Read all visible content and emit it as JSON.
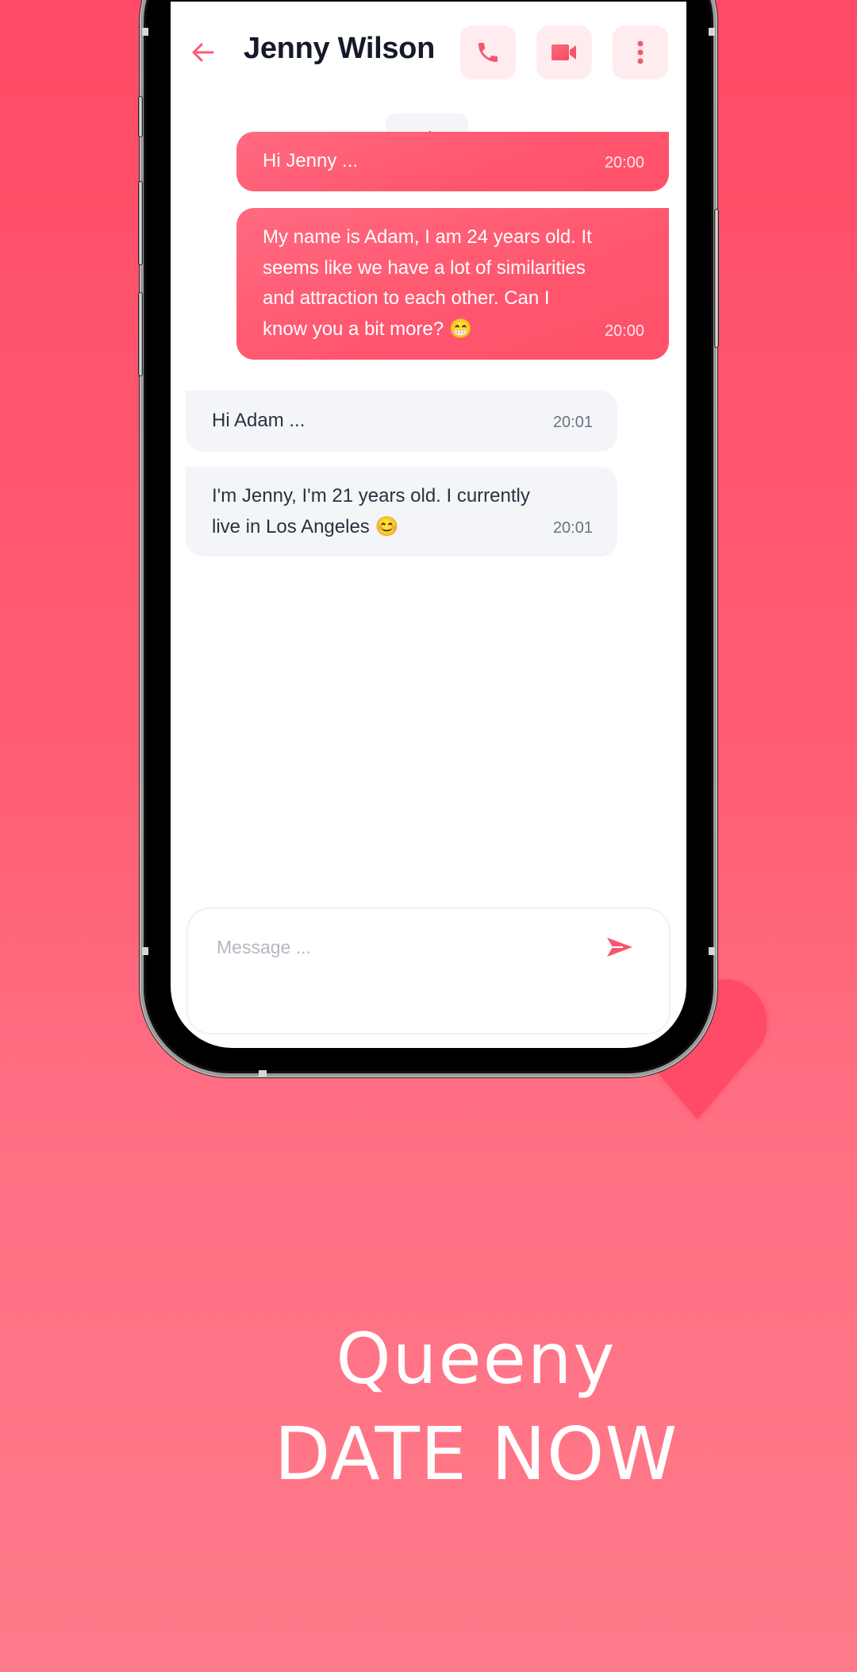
{
  "chat": {
    "contact_name": "Jenny Wilson",
    "header_actions": [
      {
        "name": "call",
        "icon": "phone-icon"
      },
      {
        "name": "video-call",
        "icon": "video-camera-icon"
      },
      {
        "name": "more",
        "icon": "more-vertical-icon"
      }
    ],
    "date_divider": "Today",
    "messages": [
      {
        "direction": "sent",
        "text": "Hi Jenny ...",
        "time": "20:00"
      },
      {
        "direction": "sent",
        "lines": [
          "My name is Adam, I am 24 years old. It",
          "seems like we have a lot of similarities",
          "and attraction to each other. Can I",
          "know you a bit more? 😁"
        ],
        "time": "20:00"
      },
      {
        "direction": "received",
        "text": "Hi Adam ...",
        "time": "20:01"
      },
      {
        "direction": "received",
        "lines": [
          "I'm Jenny, I'm 21 years old. I currently",
          "live in Los Angeles 😊"
        ],
        "time": "20:01"
      }
    ],
    "input": {
      "placeholder": "Message ...",
      "value": ""
    }
  },
  "promo": {
    "line1": "Queeny",
    "line2": "DATE NOW"
  },
  "colors": {
    "accent": "#ff566f",
    "accent_soft": "#ffecef",
    "received_bubble": "#f3f5f9",
    "background_top": "#ff4b67",
    "background_bottom": "#ff7a8a",
    "heart": "#ff4a68"
  }
}
